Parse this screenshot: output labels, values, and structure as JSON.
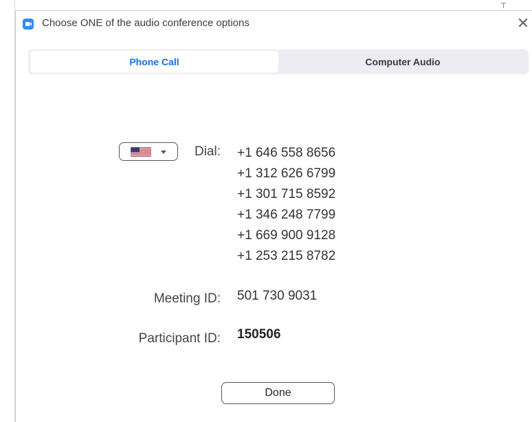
{
  "window": {
    "title": "Choose ONE of the audio conference options",
    "close_glyph": "✕",
    "app_icon": "zoom-camera-icon"
  },
  "tabs": [
    {
      "label": "Phone Call",
      "selected": true
    },
    {
      "label": "Computer Audio",
      "selected": false
    }
  ],
  "country": {
    "selected": "US",
    "flag_icon": "us-flag-icon"
  },
  "dial": {
    "label": "Dial:",
    "numbers": [
      "+1 646 558 8656",
      "+1 312 626 6799",
      "+1 301 715 8592",
      "+1 346 248 7799",
      "+1 669 900 9128",
      "+1 253 215 8782"
    ]
  },
  "meeting": {
    "label": "Meeting ID:",
    "value": "501 730 9031"
  },
  "participant": {
    "label": "Participant ID:",
    "value": "150506"
  },
  "done_label": "Done",
  "colors": {
    "accent": "#0e71eb",
    "zoom_blue": "#2d8cff",
    "tab_bg": "#ececf2"
  }
}
